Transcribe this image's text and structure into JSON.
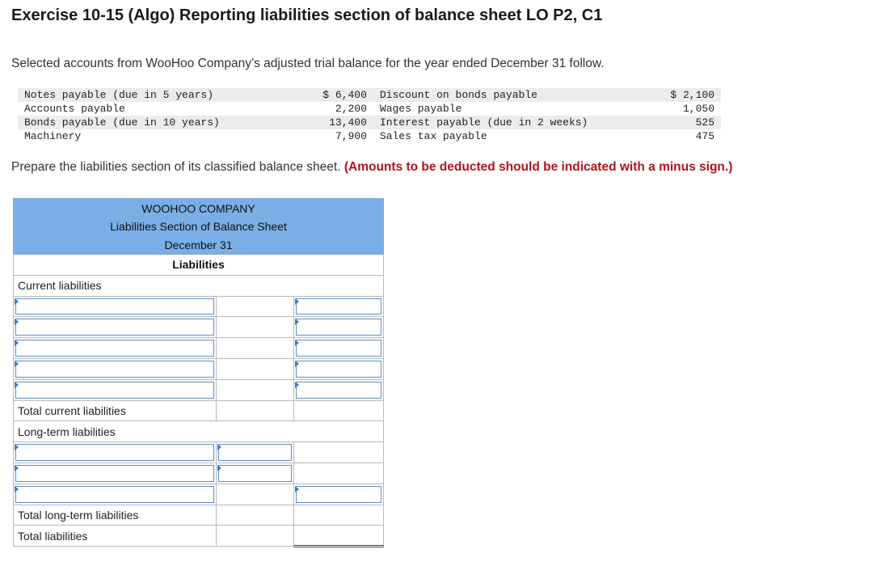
{
  "title": "Exercise 10-15 (Algo) Reporting liabilities section of balance sheet LO P2, C1",
  "intro": "Selected accounts from WooHoo Company’s adjusted trial balance for the year ended December 31 follow.",
  "trial_balance": [
    {
      "left_label": "Notes payable (due in 5 years)",
      "left_amount": "$ 6,400",
      "right_label": "Discount on bonds payable",
      "right_amount": "$ 2,100"
    },
    {
      "left_label": "Accounts payable",
      "left_amount": "2,200",
      "right_label": "Wages payable",
      "right_amount": "1,050"
    },
    {
      "left_label": "Bonds payable (due in 10 years)",
      "left_amount": "13,400",
      "right_label": "Interest payable (due in 2 weeks)",
      "right_amount": "525"
    },
    {
      "left_label": "Machinery",
      "left_amount": "7,900",
      "right_label": "Sales tax payable",
      "right_amount": "475"
    }
  ],
  "instruction": "Prepare the liabilities section of its classified balance sheet.",
  "instruction_warning": "(Amounts to be deducted should be indicated with a minus sign.)",
  "sheet": {
    "company": "WOOHOO COMPANY",
    "subtitle": "Liabilities Section of Balance Sheet",
    "date": "December 31",
    "section": "Liabilities",
    "current_label": "Current liabilities",
    "total_current_label": "Total current liabilities",
    "long_term_label": "Long-term liabilities",
    "total_long_term_label": "Total long-term liabilities",
    "total_liabilities_label": "Total liabilities"
  },
  "colors": {
    "header_blue": "#7aaee6",
    "input_border": "#5b8ec6",
    "warning_red": "#b5121b"
  }
}
